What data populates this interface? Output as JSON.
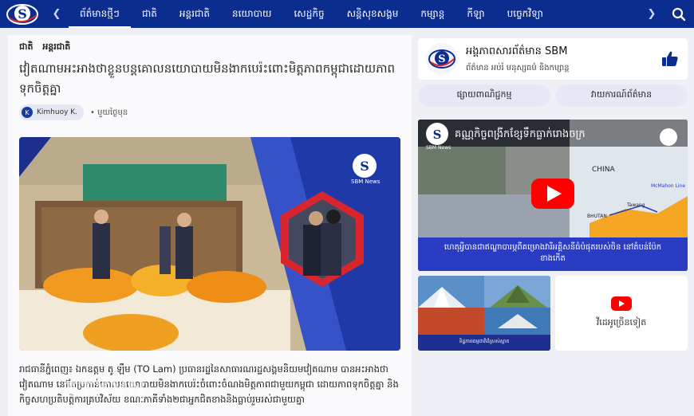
{
  "colors": {
    "brand_blue": "#0b2d8f",
    "accent_red": "#d7262e",
    "youtube_red": "#ff0000"
  },
  "nav": {
    "items": [
      "ព័ត៌មានថ្មីៗ",
      "ជាតិ",
      "អន្តរជាតិ",
      "នយោបាយ",
      "សេដ្ឋកិច្ច",
      "សន្តិសុខសង្គម",
      "កម្សាន្ត",
      "កីឡា",
      "បច្ចេកវិទ្យា"
    ],
    "prev_icon": "chevron-left-icon",
    "next_icon": "chevron-right-icon",
    "search_icon": "search-icon"
  },
  "article": {
    "categories": [
      "ជាតិ",
      "អន្តរជាតិ"
    ],
    "title": "វៀតណាមអះអាងថាខ្លួនបន្តគោលនយោបាយមិនងាកបេរ៉ះពោះមិត្តភាពកម្ពុជាដោយភាពទុកចិត្តគ្នា",
    "author_initial": "K",
    "author": "Kimhuoy K.",
    "time": "មួយថ្ងៃមុន",
    "image_logo_text": "SBM News",
    "body": "រាជធានីភ្នំពេញ៖ ឯកឧត្តម តូ ឡឹម (TO Lam) ប្រធានរដ្ឋនៃសាធារណរដ្ឋសង្គមនិយមវៀតណាម បានអះអាងថា វៀតណាម នៅតែប្រកាន់គោលនយោបាយមិនងាកបេរ៉ះចំពោះចំណងមិត្តភាពជាមួយកម្ពុជា ដោយភាពទុកចិត្តគ្នា និងកិច្ចសហប្រតិបត្តិការគ្រប់វិស័យ ខណៈភាគីទាំង២ជាអ្នកជិតខាងនិងធ្លាប់រួមរស់ជាមួយគ្នា",
    "watermark": "TTXVN"
  },
  "sidebar": {
    "page_name": "អង្គភាពសារព័ត៌មាន SBM",
    "page_sub": "ព័ត៌មាន អប់រំ មនុស្សធម៌ និងកម្សាន្ត",
    "buttons": [
      "ផ្សាយពាណិជ្ជកម្ម",
      "វាយការណ៍ព័ត៌មាន"
    ],
    "video": {
      "title": "គណ្ណកិច្ចពង្រីកខ្សែទឹកធ្លាក់រោងចក្រ",
      "channel_label": "SBM News",
      "map_labels": [
        "CHINA",
        "McMahon Line",
        "BHUTAN",
        "Tawang"
      ],
      "caption": "ហេតុអ្វីបានជាឥណ្ឌាបារម្ភពីគម្រោងវារីអគ្គិសនីធំបំផុតរបស់ចិន នៅតំបន់ប៉ែកខាងកើត"
    },
    "thumb_caption": "ទិដ្ឋភាពធម្មជាតិដ៏ស្រស់ស្អាត",
    "more_label": "វីដេអូច្រើនទៀត"
  }
}
